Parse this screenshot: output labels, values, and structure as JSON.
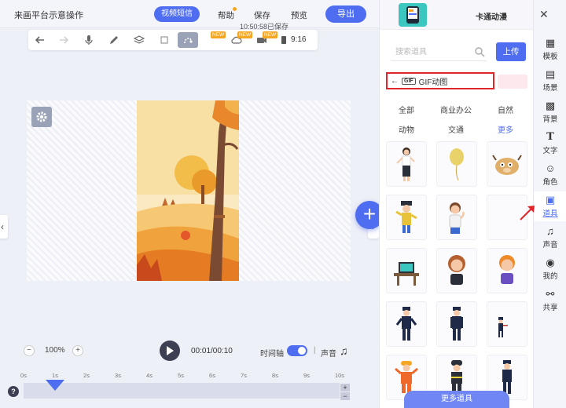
{
  "app": {
    "title": "来画平台示意操作"
  },
  "header": {
    "video_mode": "视频短信",
    "help": "帮助",
    "save": "保存",
    "preview": "预览",
    "export": "导出"
  },
  "toolbar": {
    "new_badge": "NEW",
    "save_status": "10:50:58已保存",
    "ratio": "9:16"
  },
  "playback": {
    "zoom_out": "−",
    "zoom_level": "100%",
    "zoom_in": "+",
    "time": "00:01/00:10",
    "timeline_label": "时间轴",
    "separator": "|",
    "sound_label": "声音"
  },
  "ruler": {
    "ticks": [
      "0s",
      "1s",
      "2s",
      "3s",
      "4s",
      "5s",
      "6s",
      "7s",
      "8s",
      "9s",
      "10s"
    ]
  },
  "track": {
    "plus": "+",
    "minus": "−"
  },
  "help_button": "?",
  "library": {
    "category_title": "卡通动漫",
    "search_placeholder": "搜索道具",
    "upload": "上传",
    "breadcrumb": {
      "badge": "GIF",
      "label": "GIF动图"
    },
    "filters_row1": [
      "全部",
      "商业办公",
      "自然"
    ],
    "filters_row2": [
      "动物",
      "交通",
      "更多"
    ],
    "items": [
      "woman-office",
      "balloon",
      "cartoon-cow",
      "doll-costume",
      "boy-thinking",
      "empty",
      "laptop-desk",
      "girl-brown-hair",
      "boy-orange-hair",
      "police-1",
      "police-2",
      "police-3",
      "construction-worker",
      "firefighter",
      "police-4"
    ],
    "more_button": "更多道具"
  },
  "sidebar": {
    "close": "✕",
    "items": [
      {
        "label": "模板",
        "icon": "template-icon"
      },
      {
        "label": "场景",
        "icon": "scene-icon"
      },
      {
        "label": "背景",
        "icon": "background-icon"
      },
      {
        "label": "文字",
        "icon": "text-icon"
      },
      {
        "label": "角色",
        "icon": "character-icon"
      },
      {
        "label": "道具",
        "icon": "prop-icon",
        "active": true
      },
      {
        "label": "声音",
        "icon": "music-icon"
      },
      {
        "label": "我的",
        "icon": "user-icon"
      },
      {
        "label": "共享",
        "icon": "share-icon"
      }
    ]
  },
  "colors": {
    "accent": "#4e6df0",
    "highlight": "#e0252b",
    "badge": "#f5a623"
  }
}
